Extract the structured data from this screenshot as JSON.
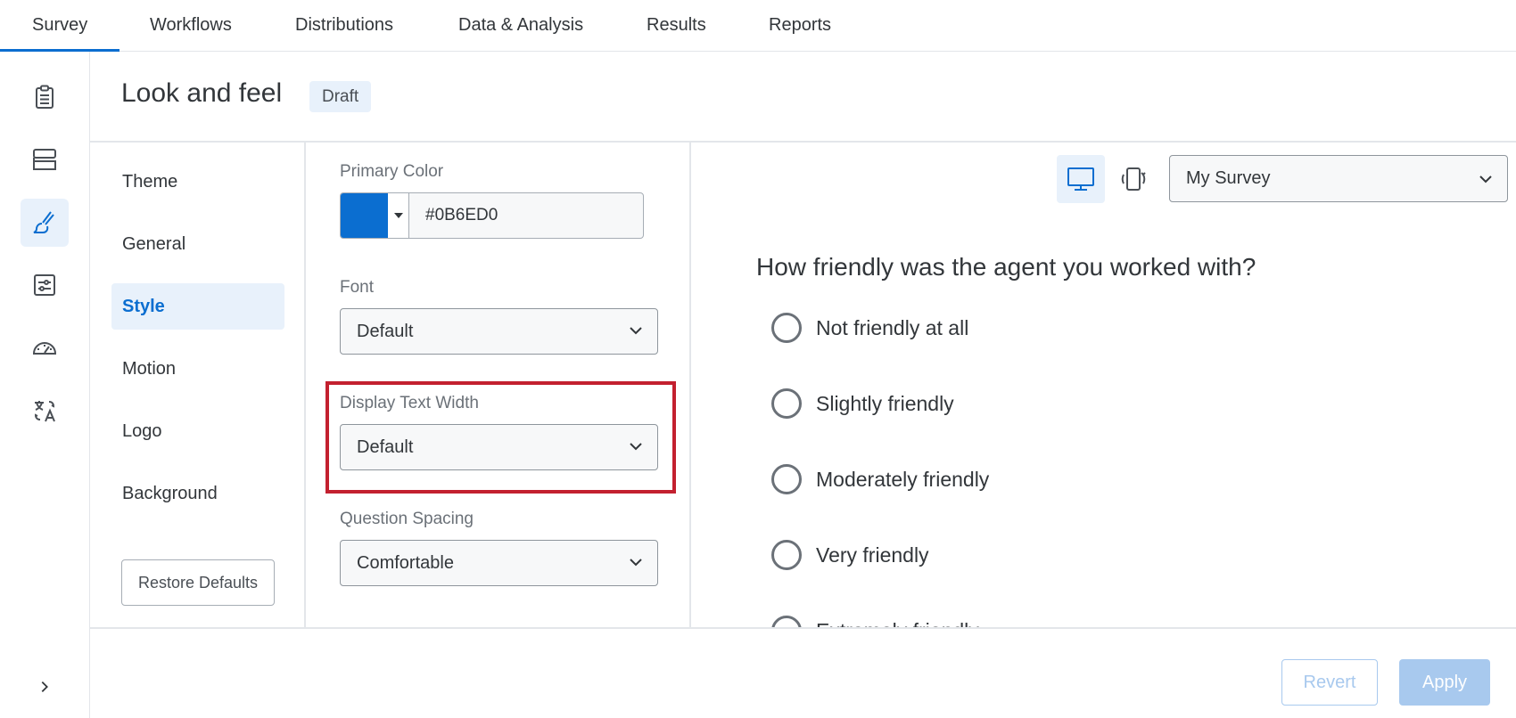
{
  "nav": {
    "tabs": [
      {
        "label": "Survey",
        "active": true
      },
      {
        "label": "Workflows"
      },
      {
        "label": "Distributions"
      },
      {
        "label": "Data & Analysis"
      },
      {
        "label": "Results"
      },
      {
        "label": "Reports"
      }
    ]
  },
  "rail": {
    "icons": [
      "clipboard-icon",
      "blocks-icon",
      "paintbrush-icon",
      "options-icon",
      "gauge-icon",
      "translate-icon"
    ],
    "active": "paintbrush-icon",
    "expand_icon": "chevron-right-icon"
  },
  "page": {
    "title": "Look and feel",
    "status_badge": "Draft"
  },
  "sections": {
    "items": [
      "Theme",
      "General",
      "Style",
      "Motion",
      "Logo",
      "Background"
    ],
    "active": "Style",
    "restore_label": "Restore Defaults"
  },
  "style": {
    "primary_color_label": "Primary Color",
    "primary_color_value": "#0B6ED0",
    "font_label": "Font",
    "font_value": "Default",
    "display_text_width_label": "Display Text Width",
    "display_text_width_value": "Default",
    "question_spacing_label": "Question Spacing",
    "question_spacing_value": "Comfortable"
  },
  "preview": {
    "survey_select": "My Survey",
    "question": "How friendly was the agent you worked with?",
    "choices": [
      "Not friendly at all",
      "Slightly friendly",
      "Moderately friendly",
      "Very friendly",
      "Extremely friendly"
    ]
  },
  "footer": {
    "revert_label": "Revert",
    "apply_label": "Apply"
  },
  "colors": {
    "accent": "#0B6ED0",
    "highlight": "#C3202F",
    "disabled_button": "#A8C9EE"
  }
}
